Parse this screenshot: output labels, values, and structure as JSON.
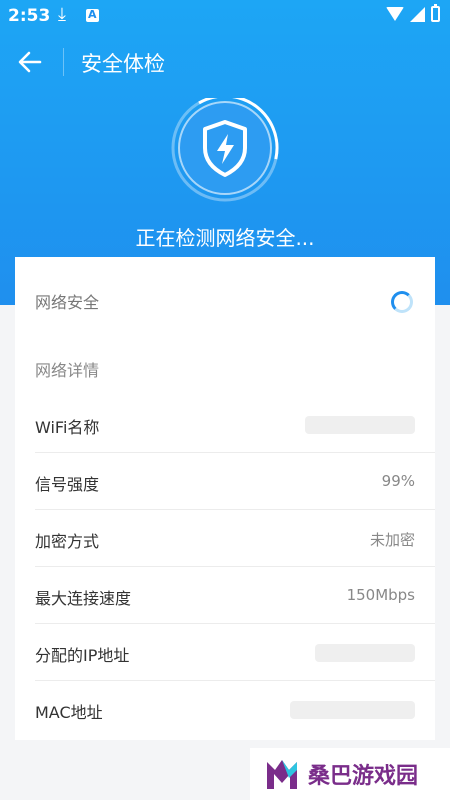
{
  "status_bar": {
    "time": "2:53"
  },
  "app_bar": {
    "title": "安全体检"
  },
  "scan": {
    "status_text": "正在检测网络安全..."
  },
  "network_security": {
    "label": "网络安全"
  },
  "details": {
    "section_label": "网络详情",
    "rows": [
      {
        "label": "WiFi名称",
        "value": ""
      },
      {
        "label": "信号强度",
        "value": "99%"
      },
      {
        "label": "加密方式",
        "value": "未加密"
      },
      {
        "label": "最大连接速度",
        "value": "150Mbps"
      },
      {
        "label": "分配的IP地址",
        "value": ""
      },
      {
        "label": "MAC地址",
        "value": ""
      }
    ]
  },
  "watermark": {
    "text": "桑巴游戏园"
  },
  "colors": {
    "primary": "#1f8fee",
    "hero_top": "#1da6f5",
    "card_bg": "#ffffff"
  },
  "icons": [
    "download-icon",
    "app-icon",
    "wifi-icon",
    "signal-icon",
    "battery-icon",
    "back-arrow-icon",
    "shield-bolt-icon",
    "loading-spinner-icon"
  ]
}
